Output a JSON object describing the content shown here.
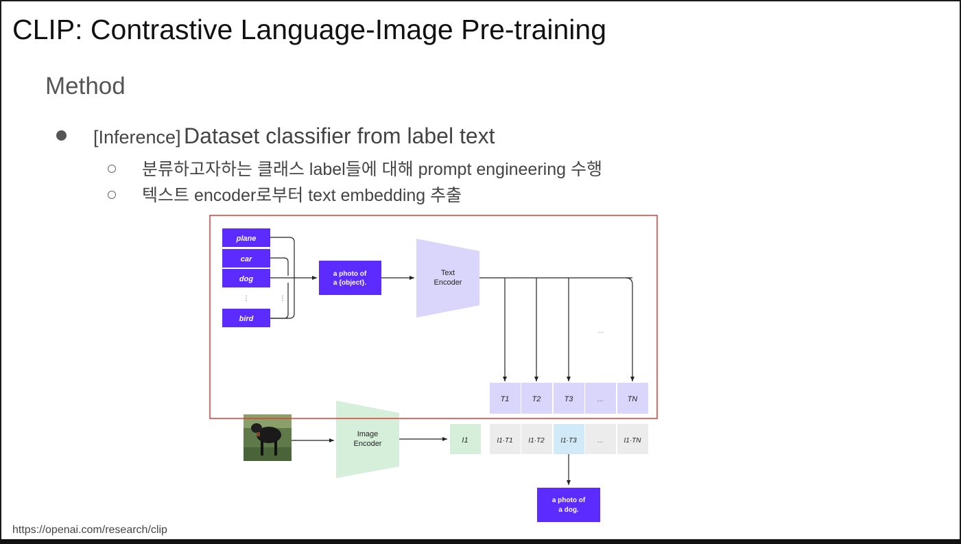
{
  "slide": {
    "title": "CLIP: Contrastive Language-Image Pre-training",
    "subtitle": "Method",
    "bullet_tag": "[Inference]",
    "bullet_main": "Dataset classifier from label text",
    "sub_bullets": [
      "분류하고자하는 클래스 label들에 대해 prompt engineering 수행",
      "텍스트 encoder로부터 text embedding 추출"
    ],
    "source_url": "https://openai.com/research/clip"
  },
  "diagram": {
    "labels": [
      "plane",
      "car",
      "dog",
      "bird"
    ],
    "ellipsis": "⋮",
    "prompt_line1": "a photo of",
    "prompt_line2": "a {object}.",
    "text_encoder_line1": "Text",
    "text_encoder_line2": "Encoder",
    "image_encoder_line1": "Image",
    "image_encoder_line2": "Encoder",
    "text_embeddings": [
      "T1",
      "T2",
      "T3",
      "...",
      "TN"
    ],
    "image_embedding": "I1",
    "similarities": [
      "I1·T1",
      "I1·T2",
      "I1·T3",
      "...",
      "I1·TN"
    ],
    "dots": "...",
    "result_line1": "a photo of",
    "result_line2": "a dog.",
    "colors": {
      "purple": "#5b2bff",
      "lavender": "#d9d5fb",
      "mint": "#d6efdb",
      "gray_cell": "#ececec",
      "highlight_cell": "#d2eaf8",
      "highlight_box": "#e23b34"
    }
  }
}
